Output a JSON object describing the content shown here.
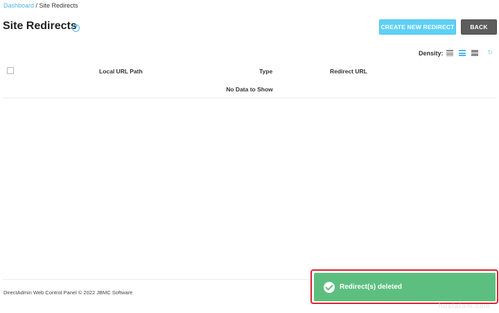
{
  "breadcrumb": {
    "home": "Dashboard",
    "separator": " / ",
    "current": "Site Redirects"
  },
  "page": {
    "title": "Site Redirects",
    "help_icon": "help-circle-icon"
  },
  "actions": {
    "create_label": "Create New Redirect",
    "back_label": "Back"
  },
  "density": {
    "label": "Density:",
    "options": [
      "compact",
      "normal",
      "comfortable"
    ],
    "selected": "normal"
  },
  "table": {
    "columns": [
      "Local URL Path",
      "Type",
      "Redirect URL"
    ],
    "empty_text": "No Data to Show"
  },
  "footer": {
    "text": "DirectAdmin Web Control Panel © 2022 JBMC Software"
  },
  "toast": {
    "message": "Redirect(s) deleted",
    "icon": "check-circle-icon"
  },
  "watermark": {
    "text": "hostatom.com"
  },
  "colors": {
    "accent": "#4fb3e8",
    "create_button": "#5fd0f5",
    "back_button": "#5d5d5d",
    "toast": "#5dbf7f",
    "highlight": "#d9232f"
  }
}
